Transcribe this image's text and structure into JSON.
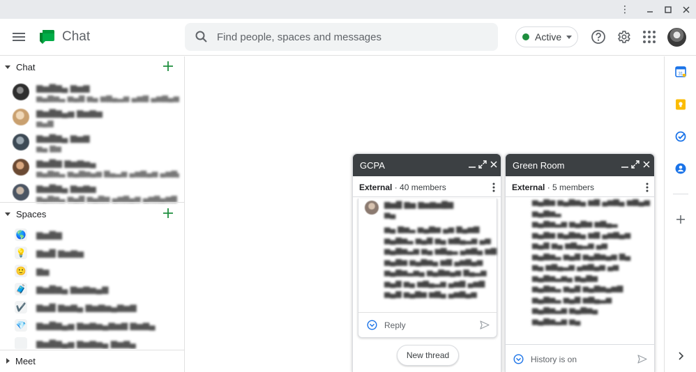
{
  "app": {
    "title": "Chat"
  },
  "search": {
    "placeholder": "Find people, spaces and messages"
  },
  "status": {
    "label": "Active",
    "color": "#1e8e3e"
  },
  "sidebar": {
    "chat_section": {
      "label": "Chat"
    },
    "spaces_section": {
      "label": "Spaces"
    },
    "meet_section": {
      "label": "Meet"
    }
  },
  "popouts": {
    "gcpa": {
      "title": "GCPA",
      "external_label": "External",
      "members": "· 40 members",
      "reply_label": "Reply",
      "new_thread_label": "New thread"
    },
    "green_room": {
      "title": "Green Room",
      "external_label": "External",
      "members": "· 5 members",
      "history_label": "History is on"
    }
  },
  "colors": {
    "accent": "#1a73e8",
    "brand_green": "#00832d",
    "header_dark": "#3c4043"
  }
}
